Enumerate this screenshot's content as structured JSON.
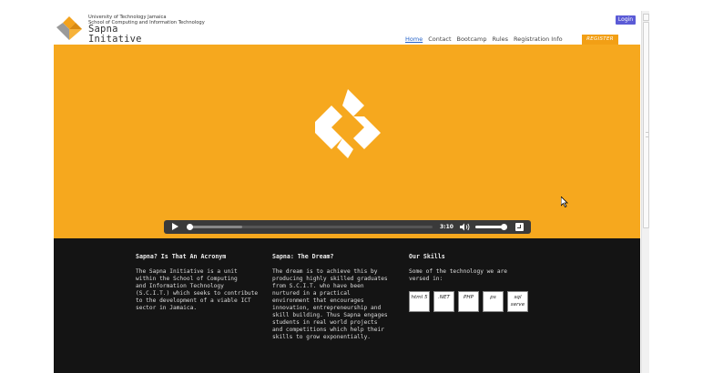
{
  "header": {
    "university": "University of Technology Jamaica",
    "school": "School of Computing and Information Technology",
    "brand_line1": "Sapna",
    "brand_line2": "Initative",
    "login_label": "Login"
  },
  "nav": {
    "items": [
      {
        "label": "Home",
        "active": true
      },
      {
        "label": "Contact",
        "active": false
      },
      {
        "label": "Bootcamp",
        "active": false
      },
      {
        "label": "Rules",
        "active": false
      },
      {
        "label": "Registration Info",
        "active": false
      }
    ],
    "register_label": "REGISTER"
  },
  "video": {
    "time": "3:10",
    "progress_fraction": 0.0,
    "buffered_fraction": 0.22,
    "volume_fraction": 1.0
  },
  "sections": [
    {
      "title": "Sapna? Is That An Acronym",
      "body": "The Sapna Initiative is a unit\nwithin the School of Computing\nand Information Technology\n(S.C.I.T.) which seeks to contribute\nto the development of a viable ICT\nsector in Jamaica."
    },
    {
      "title": "Sapna: The Dream?",
      "body": "The dream is to achieve this by\nproducing highly skilled graduates\nfrom S.C.I.T. who have been\nnurtured in a practical\nenvironment that encourages\ninnovation, entrepreneurship and\nskill building. Thus Sapna engages\nstudents in real world projects\nand competitions which help their\nskills to grow exponentially."
    },
    {
      "title": "Our Skills",
      "body": "Some of the technology we are\nversed in:"
    }
  ],
  "skills": [
    "html 5",
    ".NET",
    "PHP",
    "ps",
    "sql serve"
  ],
  "colors": {
    "hero_bg": "#f6a81e",
    "footer_bg": "#141414",
    "nav_active": "#2563c9",
    "register_bg": "#f29f15",
    "login_bg": "#5b5bd6"
  }
}
